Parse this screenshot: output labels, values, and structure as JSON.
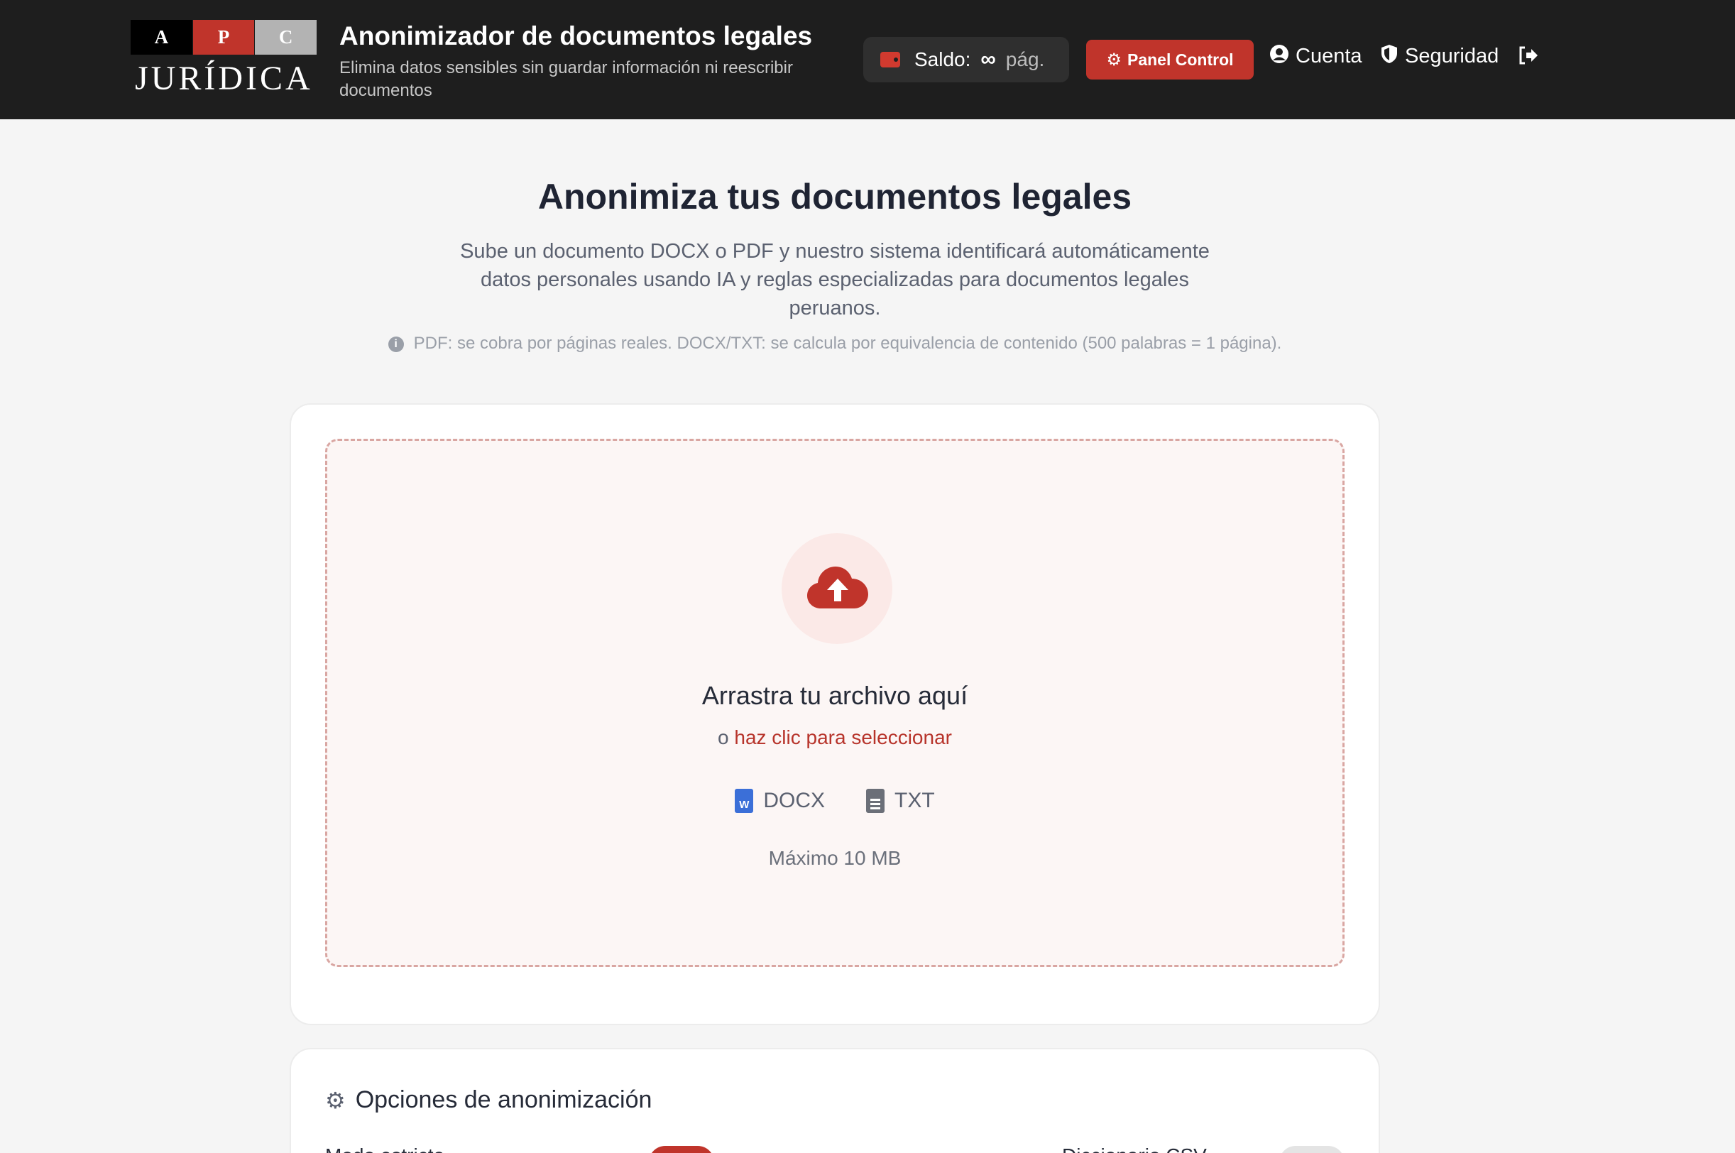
{
  "header": {
    "logo_letters": [
      "A",
      "P",
      "C"
    ],
    "logo_word": "JURÍDICA",
    "title": "Anonimizador de documentos legales",
    "subtitle": "Elimina datos sensibles sin guardar información ni reescribir documentos",
    "saldo_label": "Saldo:",
    "saldo_value": "∞",
    "saldo_unit": "pág.",
    "panel_button": "Panel Control",
    "cuenta": "Cuenta",
    "seguridad": "Seguridad",
    "icons": {
      "wallet": "wallet-icon",
      "gear": "gear-icon",
      "user": "user-circle-icon",
      "shield": "shield-icon",
      "logout": "logout-icon"
    }
  },
  "hero": {
    "title": "Anonimiza tus documentos legales",
    "description": "Sube un documento DOCX o PDF y nuestro sistema identificará automáticamente datos personales usando IA y reglas especializadas para documentos legales peruanos.",
    "note": "PDF: se cobra por páginas reales. DOCX/TXT: se calcula por equivalencia de contenido (500 palabras = 1 página)."
  },
  "upload": {
    "title": "Arrastra tu archivo aquí",
    "prefix": "o",
    "link": "haz clic para seleccionar",
    "formats": [
      "DOCX",
      "TXT"
    ],
    "max": "Máximo 10 MB"
  },
  "options": {
    "title": "Opciones de anonimización",
    "strict_mode": "Modo estricto",
    "csv_dictionary": "Diccionario CSV",
    "strict_on": true,
    "csv_on": false
  },
  "colors": {
    "accent": "#c0342b",
    "header_bg": "#1e1e1e",
    "docx": "#3b6fd8"
  }
}
